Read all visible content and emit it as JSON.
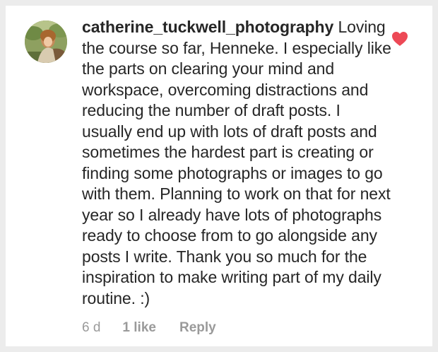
{
  "comment": {
    "username": "catherine_tuckwell_photography",
    "text": "Loving the course so far, Henneke. I especially like the parts on clearing your mind and workspace, overcoming distractions and reducing the number of draft posts. I usually end up with lots of draft posts and sometimes the hardest part is creating or finding some photographs or images to go with them. Planning to work on that for next year so I already have lots of photographs ready to choose from to go alongside any posts I write. Thank you so much for the inspiration to make writing part of my daily routine. :)",
    "liked": true,
    "like_icon": "heart-filled-icon"
  },
  "meta": {
    "time": "6 d",
    "likes": "1 like",
    "reply": "Reply"
  },
  "colors": {
    "heart": "#ed4956",
    "text": "#262626",
    "muted": "#9a9a9a"
  }
}
